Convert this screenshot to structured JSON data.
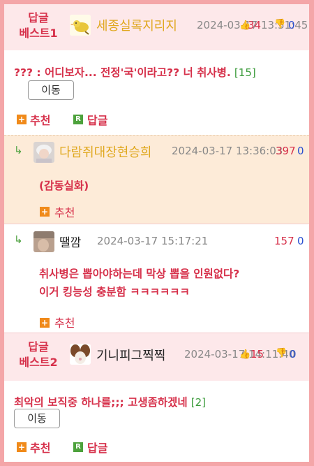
{
  "best1": {
    "badge_line1": "답글",
    "badge_line2": "베스트1",
    "nickname": "세종실록지리지",
    "date": "2024-03-17 13:51:45",
    "score": "34",
    "score_down": "0",
    "text": "??? : 어디보자... 전정'국'이라고?? 너 취사병.",
    "reply_count": "[15]",
    "move_label": "이동",
    "recommend_label": "추천",
    "reply_label": "답글"
  },
  "reply1": {
    "nickname": "다람쥐대장현승희",
    "date": "2024-03-17 13:36:03",
    "score_up": "397",
    "score_down": "0",
    "text": "(감동실화)",
    "recommend_label": "추천"
  },
  "reply2": {
    "nickname": "땔깜",
    "date": "2024-03-17 15:17:21",
    "score_up": "157",
    "score_down": "0",
    "text_line1": "취사병은 뽑아야하는데 막상 뽑을 인원없다?",
    "text_line2": "이거 킹능성 충분함 ㅋㅋㅋㅋㅋㅋ",
    "recommend_label": "추천"
  },
  "best2": {
    "badge_line1": "답글",
    "badge_line2": "베스트2",
    "nickname": "기니피그찍찍",
    "date": "2024-03-17 14:11:40",
    "score": "15",
    "score_down": "0",
    "text": "최악의 보직중 하나를;;; 고생좀하겠네",
    "reply_count": "[2]",
    "move_label": "이동",
    "recommend_label": "추천",
    "reply_label": "답글"
  },
  "colors": {
    "frame": "#f4a6a8",
    "best_bg": "#fde8ea",
    "highlight_bg": "#fdebd8",
    "accent_red": "#d6304a",
    "nick_gold": "#e0a81f",
    "count_green": "#3a9a3a",
    "down_blue": "#2a50d0"
  }
}
